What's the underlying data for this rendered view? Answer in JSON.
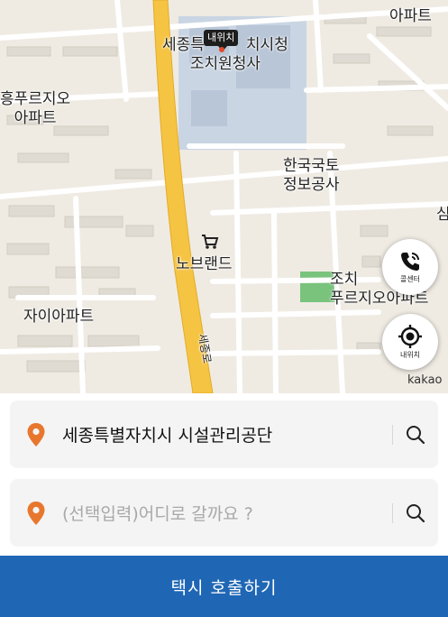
{
  "map": {
    "labels": {
      "city_hall_line1": "세종특",
      "city_hall_line1_suffix": "치시청",
      "city_hall_line2": "조치원청사",
      "top_right": "아파트",
      "left_line1": "흥푸르지오",
      "left_line2": "아파트",
      "land_line1": "한국국토",
      "land_line2": "정보공사",
      "store": "노브랜드",
      "apt_left": "자이아파트",
      "right_line1": "조치",
      "right_line2": "푸르지오아파트",
      "road": "세종로",
      "edge_right": "심"
    },
    "my_location_pin": "내위치",
    "attribution": "kakao"
  },
  "fabs": {
    "call_center_label": "콜센터",
    "my_location_label": "내위치"
  },
  "origin": {
    "value": "세종특별자치시 시설관리공단"
  },
  "destination": {
    "placeholder": "(선택입력)어디로 갈까요 ?"
  },
  "call_button_label": "택시 호출하기",
  "colors": {
    "accent_blue": "#1f67b5",
    "pin_orange": "#e8772e",
    "road_yellow": "#f5c542"
  }
}
